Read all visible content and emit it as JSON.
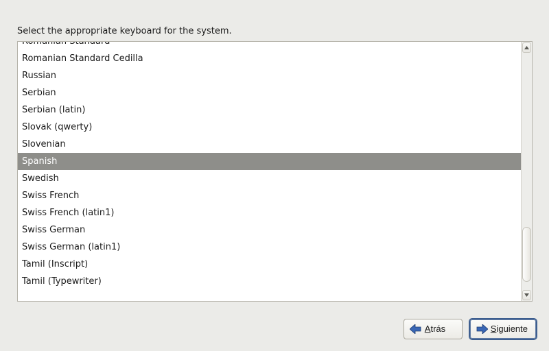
{
  "instruction": "Select the appropriate keyboard for the system.",
  "keyboard_list": {
    "selected_index": 7,
    "items": [
      "Romanian Standard",
      "Romanian Standard Cedilla",
      "Russian",
      "Serbian",
      "Serbian (latin)",
      "Slovak (qwerty)",
      "Slovenian",
      "Spanish",
      "Swedish",
      "Swiss French",
      "Swiss French (latin1)",
      "Swiss German",
      "Swiss German (latin1)",
      "Tamil (Inscript)",
      "Tamil (Typewriter)"
    ]
  },
  "buttons": {
    "back": {
      "label": "Atrás",
      "mnemonic_index": 0
    },
    "next": {
      "label": "Siguiente",
      "mnemonic_index": 0
    }
  },
  "icons": {
    "back_arrow_color": "#3a67b5",
    "next_arrow_color": "#3a67b5"
  }
}
